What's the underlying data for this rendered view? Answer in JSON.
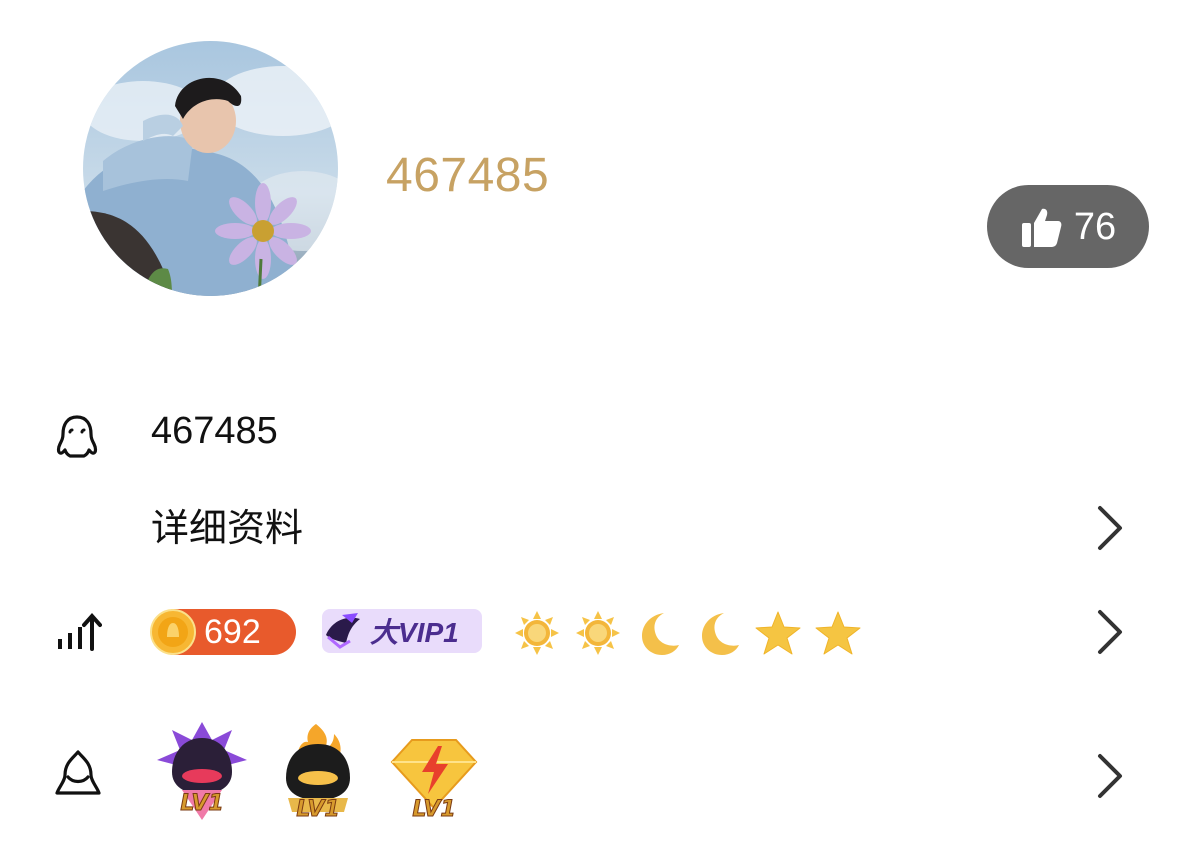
{
  "profile": {
    "nickname": "467485",
    "likes": "76"
  },
  "info": {
    "qq_number": "467485",
    "detail_label": "详细资料"
  },
  "level": {
    "points": "692",
    "vip_label": "大VIP1",
    "icons": [
      "sun-icon",
      "sun-icon",
      "moon-icon",
      "moon-icon",
      "star-icon",
      "star-icon"
    ]
  },
  "badges": [
    {
      "name": "badge-lv1-purple",
      "label": "LV1"
    },
    {
      "name": "badge-lv1-flame",
      "label": "LV1"
    },
    {
      "name": "badge-lv1-diamond",
      "label": "LV1"
    }
  ],
  "colors": {
    "nickname": "#c7a263",
    "like_button_bg": "#666666",
    "level_pill": "#e85a2c",
    "vip_pill_bg": "#e9dcfb",
    "vip_text": "#4b2d8f"
  }
}
